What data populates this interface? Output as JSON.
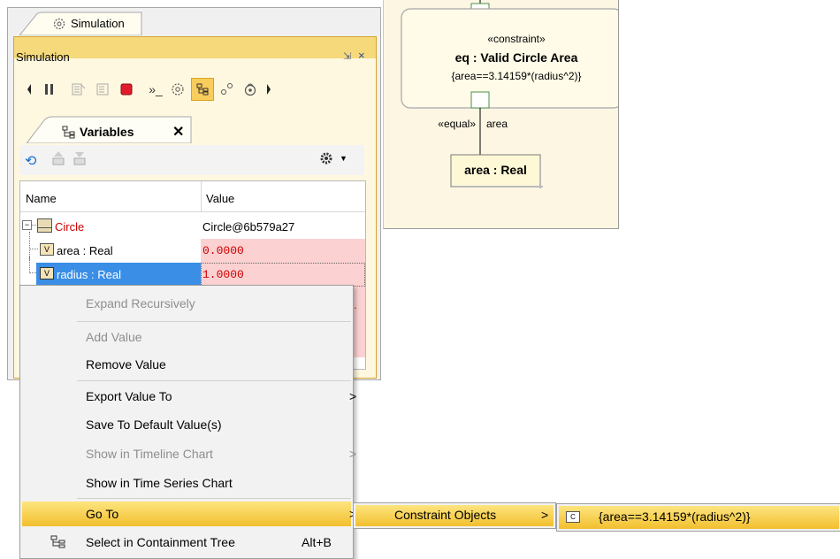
{
  "diagram": {
    "constraint_stereotype": "«constraint»",
    "constraint_name": "eq : Valid Circle Area",
    "constraint_expr": "{area==3.14159*(radius^2)}",
    "connector_stereotype": "«equal»",
    "connector_label": "area",
    "part_label": "area : Real"
  },
  "simulation": {
    "outer_tab": "Simulation",
    "panel_title": "Simulation",
    "minimize_glyph": "⇲",
    "close_glyph": "×",
    "toolbar_icons": [
      "step-back-icon",
      "pause-icon",
      "step-into-icon",
      "step-over-icon",
      "stop-icon",
      "run-to-icon",
      "simulation-icon",
      "variables-icon",
      "breakpoints-icon",
      "lock-icon",
      "step-forward-icon"
    ],
    "variables_tab": "Variables",
    "variables_close": "✕",
    "var_toolbar_icons": [
      "refresh-icon",
      "export-icon",
      "import-icon",
      "options-gear-icon"
    ],
    "columns": {
      "name": "Name",
      "value": "Value"
    },
    "rows": [
      {
        "name": "Circle",
        "value": "Circle@6b579a27"
      },
      {
        "name": "area : Real",
        "value": "0.0000"
      },
      {
        "name": "radius : Real",
        "value": "1.0000"
      }
    ],
    "colors": {
      "accent": "#f5d97a",
      "selection": "#3a8ee6",
      "value_bg": "#fcd1d2",
      "text_red": "#cc0000"
    }
  },
  "context_menu": {
    "items": [
      {
        "label": "Expand Recursively",
        "enabled": false
      },
      {
        "label": "Add Value",
        "enabled": false
      },
      {
        "label": "Remove Value",
        "enabled": true
      },
      {
        "label": "Export Value To",
        "enabled": true,
        "submenu": true
      },
      {
        "label": "Save To Default Value(s)",
        "enabled": true
      },
      {
        "label": "Show in Timeline Chart",
        "enabled": false,
        "submenu": true
      },
      {
        "label": "Show in Time Series Chart",
        "enabled": true
      },
      {
        "label": "Go To",
        "enabled": true,
        "submenu": true,
        "highlighted": true
      },
      {
        "label": "Select in Containment Tree",
        "enabled": true,
        "shortcut": "Alt+B"
      }
    ],
    "submenu_arrow": ">",
    "goto_submenu": {
      "label": "Constraint Objects",
      "arrow": ">"
    },
    "goto_target": {
      "label": "{area==3.14159*(radius^2)}"
    }
  }
}
